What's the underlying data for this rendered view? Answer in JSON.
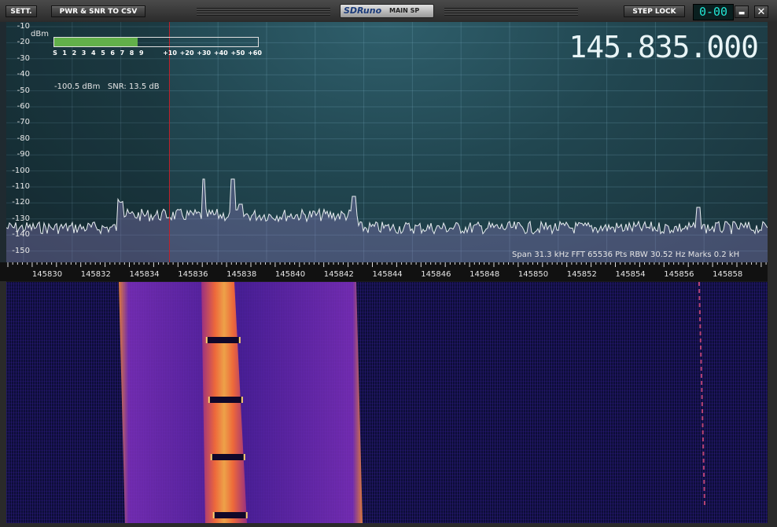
{
  "titlebar": {
    "settings_label": "SETT.",
    "csv_label": "PWR & SNR TO CSV",
    "logo_brand": "SDRuno",
    "logo_sub": "MAIN SP",
    "step_lock_label": "STEP LOCK",
    "lcd_value": "0-00",
    "minimize_glyph": "▬",
    "close_glyph": "✕"
  },
  "spectrum": {
    "unit_label": "dBm",
    "db_ticks": [
      "-10",
      "-20",
      "-30",
      "-40",
      "-50",
      "-60",
      "-70",
      "-80",
      "-90",
      "-100",
      "-110",
      "-120",
      "-130",
      "-140",
      "-150"
    ],
    "smeter_ticks": [
      "S",
      "1",
      "2",
      "3",
      "4",
      "5",
      "6",
      "7",
      "8",
      "9",
      "+10",
      "+20",
      "+30",
      "+40",
      "+50",
      "+60"
    ],
    "smeter_level_fraction": 0.41,
    "power_readout": "-100.5 dBm",
    "snr_readout": "SNR: 13.5 dB",
    "frequency_display": "145.835.000",
    "info_line": "Span 31.3 kHz   FFT 65536 Pts   RBW 30.52 Hz   Marks 0.2 kH"
  },
  "axis": {
    "freq_labels": [
      "145830",
      "145832",
      "145834",
      "145836",
      "145838",
      "145840",
      "145842",
      "145844",
      "145846",
      "145848",
      "145850",
      "145852",
      "145854",
      "145856",
      "145858"
    ]
  },
  "colors": {
    "spectrum_line": "#e8eef0",
    "marker": "#c0202a",
    "smeter_fill": "#62b04a",
    "waterfall_bg": "#0d0d38",
    "lcd": "#22e6d4"
  }
}
